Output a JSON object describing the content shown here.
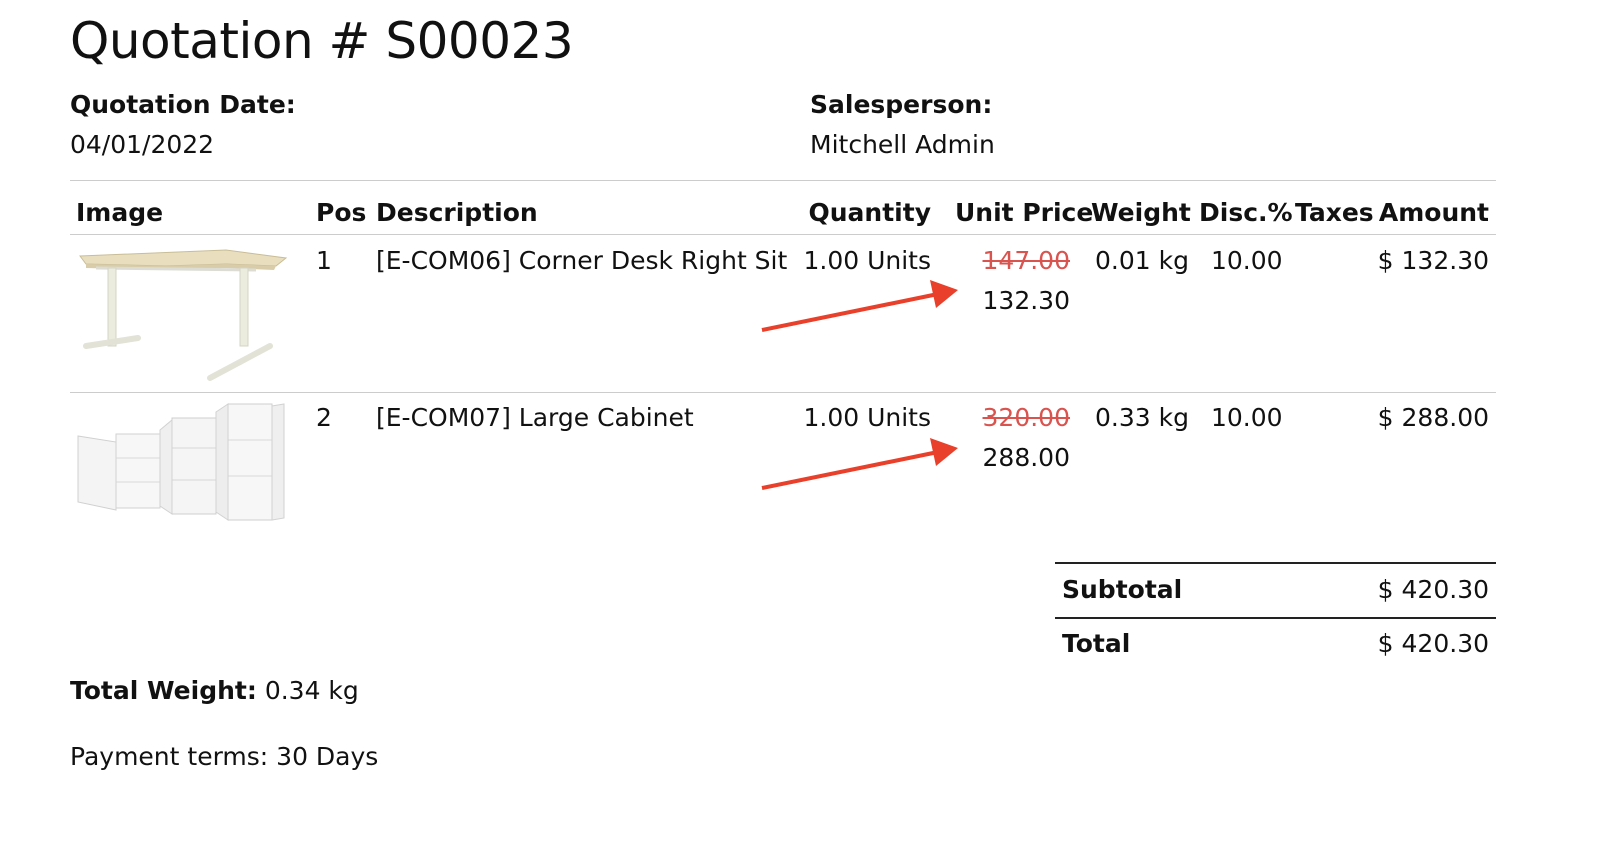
{
  "doc": {
    "title": "Quotation # S00023",
    "quotation_date_label": "Quotation Date:",
    "quotation_date": "04/01/2022",
    "salesperson_label": "Salesperson:",
    "salesperson": "Mitchell Admin"
  },
  "table": {
    "headers": {
      "image": "Image",
      "pos": "Pos",
      "description": "Description",
      "quantity": "Quantity",
      "unit_price": "Unit Price",
      "weight": "Weight",
      "disc": "Disc.%",
      "taxes": "Taxes",
      "amount": "Amount"
    },
    "rows": [
      {
        "pos": "1",
        "description": "[E-COM06] Corner Desk Right Sit",
        "quantity": "1.00 Units",
        "orig_price": "147.00",
        "price": "132.30",
        "weight": "0.01 kg",
        "disc": "10.00",
        "amount": "$ 132.30",
        "image_icon": "corner-desk-image"
      },
      {
        "pos": "2",
        "description": "[E-COM07] Large Cabinet",
        "quantity": "1.00 Units",
        "orig_price": "320.00",
        "price": "288.00",
        "weight": "0.33 kg",
        "disc": "10.00",
        "amount": "$ 288.00",
        "image_icon": "cabinet-image"
      }
    ]
  },
  "totals": {
    "subtotal_label": "Subtotal",
    "subtotal": "$ 420.30",
    "total_label": "Total",
    "total": "$ 420.30"
  },
  "footer": {
    "total_weight_label": "Total Weight:",
    "total_weight": "0.34 kg",
    "payment_terms": "Payment terms: 30 Days"
  },
  "colors": {
    "arrow": "#e8402a",
    "strike": "#d9534f"
  }
}
